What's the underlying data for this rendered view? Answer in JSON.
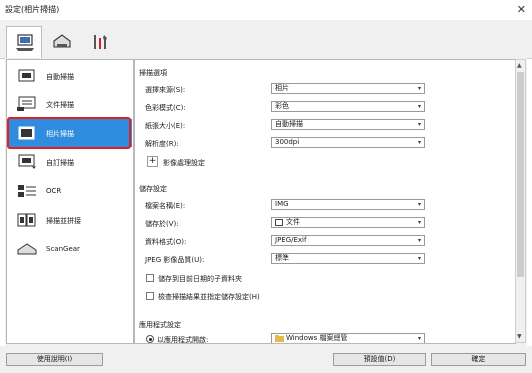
{
  "window": {
    "title": "設定(相片掃描)",
    "close_glyph": "✕"
  },
  "tabs": [
    {
      "name": "scan-from-computer",
      "icon": "computer-scan-icon",
      "active": true
    },
    {
      "name": "scan-from-panel",
      "icon": "scanner-panel-icon",
      "active": false
    },
    {
      "name": "general-settings",
      "icon": "tools-icon",
      "active": false
    }
  ],
  "sidebar": {
    "items": [
      {
        "label": "自動掃描",
        "icon": "auto-scan-icon"
      },
      {
        "label": "文件掃描",
        "icon": "document-scan-icon"
      },
      {
        "label": "相片掃描",
        "icon": "photo-scan-icon",
        "selected": true
      },
      {
        "label": "自訂掃描",
        "icon": "custom-scan-icon"
      },
      {
        "label": "OCR",
        "icon": "ocr-icon"
      },
      {
        "label": "掃描並拼接",
        "icon": "stitch-icon"
      },
      {
        "label": "ScanGear",
        "icon": "scangear-icon"
      }
    ]
  },
  "scan_options": {
    "title": "掃描選項",
    "source_label": "選擇來源(S):",
    "source_value": "相片",
    "color_label": "色彩模式(C):",
    "color_value": "彩色",
    "paper_label": "紙張大小(E):",
    "paper_value": "自動掃描",
    "resolution_label": "解析度(R):",
    "resolution_value": "300dpi",
    "image_processing_label": "影像處理設定",
    "plus": "+"
  },
  "save_settings": {
    "title": "儲存設定",
    "filename_label": "檔案名稱(E):",
    "filename_value": "IMG",
    "save_in_label": "儲存於(V):",
    "save_in_value": "文件",
    "format_label": "資料格式(O):",
    "format_value": "JPEG/Exif",
    "jpeg_quality_label": "JPEG 影像品質(U):",
    "jpeg_quality_value": "標準",
    "subfolder_label": "儲存到目前日期的子資料夾",
    "check_result_label": "檢查掃描結果並指定儲存設定(H)"
  },
  "app_settings": {
    "title": "應用程式設定",
    "open_with_label": "以應用程式開啟:",
    "open_with_value": "Windows 檔案總管"
  },
  "buttons": {
    "help": "使用說明(I)",
    "defaults": "預設值(D)",
    "ok": "確定"
  },
  "colors": {
    "selection": "#2f8cde",
    "highlight": "#e0201b"
  }
}
